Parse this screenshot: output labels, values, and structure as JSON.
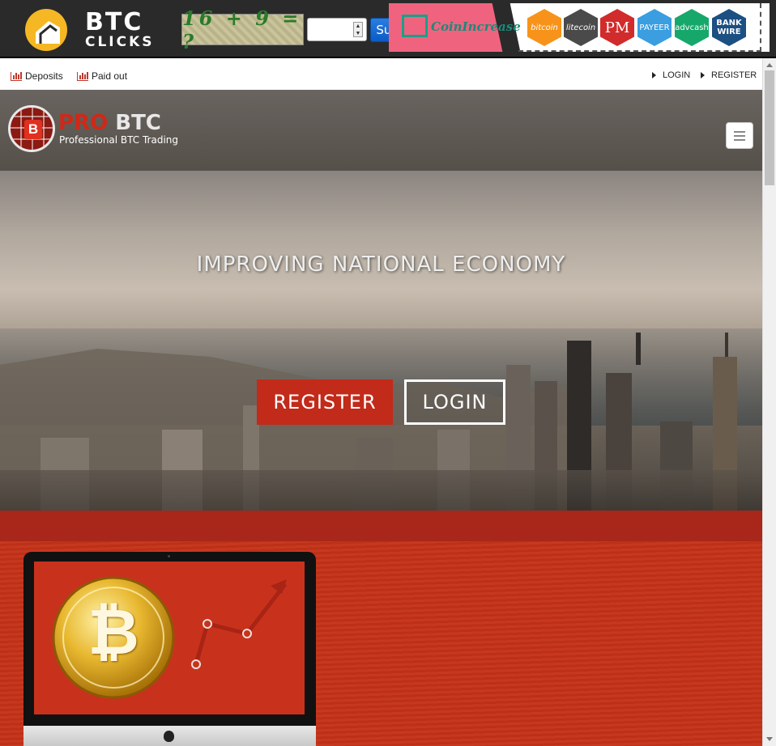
{
  "ad_bar": {
    "logo_line1": "BTC",
    "logo_line2": "CLICKS",
    "captcha_text": "16 + 9 = ?",
    "captcha_input_value": "",
    "submit_label": "Submit",
    "banner_brand": "CoinIncrease",
    "payment_badges": [
      {
        "label": "bitcoin",
        "color": "#f7931a"
      },
      {
        "label": "litecoin",
        "color": "#4a4a4a"
      },
      {
        "label": "PM",
        "color": "#d12b2b"
      },
      {
        "label": "PAYEER",
        "color": "#3a9ee0"
      },
      {
        "label": "advcash",
        "color": "#16a86a"
      },
      {
        "label": "BANK WIRE",
        "color": "#1c4f82"
      }
    ]
  },
  "topnav": {
    "deposits": "Deposits",
    "paid_out": "Paid out",
    "login": "LOGIN",
    "register": "REGISTER"
  },
  "header": {
    "brand_pro": "PRO",
    "brand_btc": "BTC",
    "tagline": "Professional BTC Trading",
    "logo_letter": "B"
  },
  "hero": {
    "title": "IMPROVING NATIONAL ECONOMY",
    "register_label": "REGISTER",
    "login_label": "LOGIN"
  },
  "feature": {
    "coin_symbol": "₿"
  },
  "colors": {
    "accent_red": "#c22a1a",
    "header_gray": "#5f5954",
    "adbar_dark": "#2a2a2a"
  }
}
